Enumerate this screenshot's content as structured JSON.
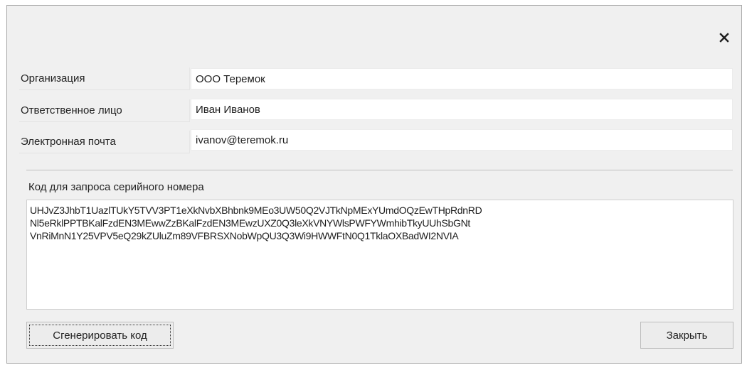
{
  "dialog": {
    "close_icon": "close-icon"
  },
  "fields": {
    "organization_label": "Организация",
    "organization_value": "ООО Теремок",
    "person_label": "Ответственное лицо",
    "person_value": "Иван Иванов",
    "email_label": "Электронная почта",
    "email_value": "ivanov@teremok.ru"
  },
  "code": {
    "label": "Код для запроса серийного номера",
    "lines": [
      "UHJvZ3JhbT1UazlTUkY5TVV3PT1eXkNvbXBhbnk9MEo3UW50Q2VJTkNpMExYUmdOQzEwTHpRdnRD",
      "Nl5eRklPPTBKalFzdEN3MEwwZzBKalFzdEN3MEwzUXZ0Q3leXkVNYWlsPWFYWmhibTkyUUhSbGNt",
      "VnRiMnN1Y25VPV5eQ29kZUluZm89VFBRSXNobWpQU3Q3Wi9HWWFtN0Q1TklaOXBadWI2NVIA"
    ]
  },
  "buttons": {
    "generate_label": "Сгенерировать код",
    "close_label": "Закрыть"
  }
}
